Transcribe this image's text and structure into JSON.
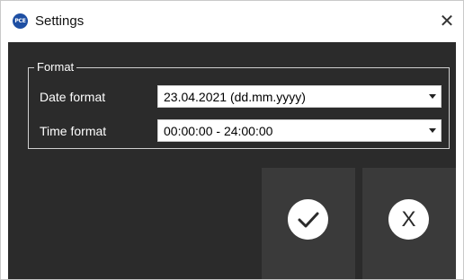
{
  "window": {
    "title": "Settings",
    "app_icon_text": "PCE",
    "close_glyph": "✕"
  },
  "format_group": {
    "title": "Format",
    "rows": [
      {
        "label": "Date format",
        "value": "23.04.2021 (dd.mm.yyyy)"
      },
      {
        "label": "Time format",
        "value": "00:00:00 - 24:00:00"
      }
    ]
  },
  "actions": {
    "confirm_icon": "checkmark-icon",
    "cancel_label": "X"
  },
  "colors": {
    "content_bg": "#2b2b2b",
    "button_bg": "#3a3a3a",
    "app_icon": "#1e4fa3"
  }
}
